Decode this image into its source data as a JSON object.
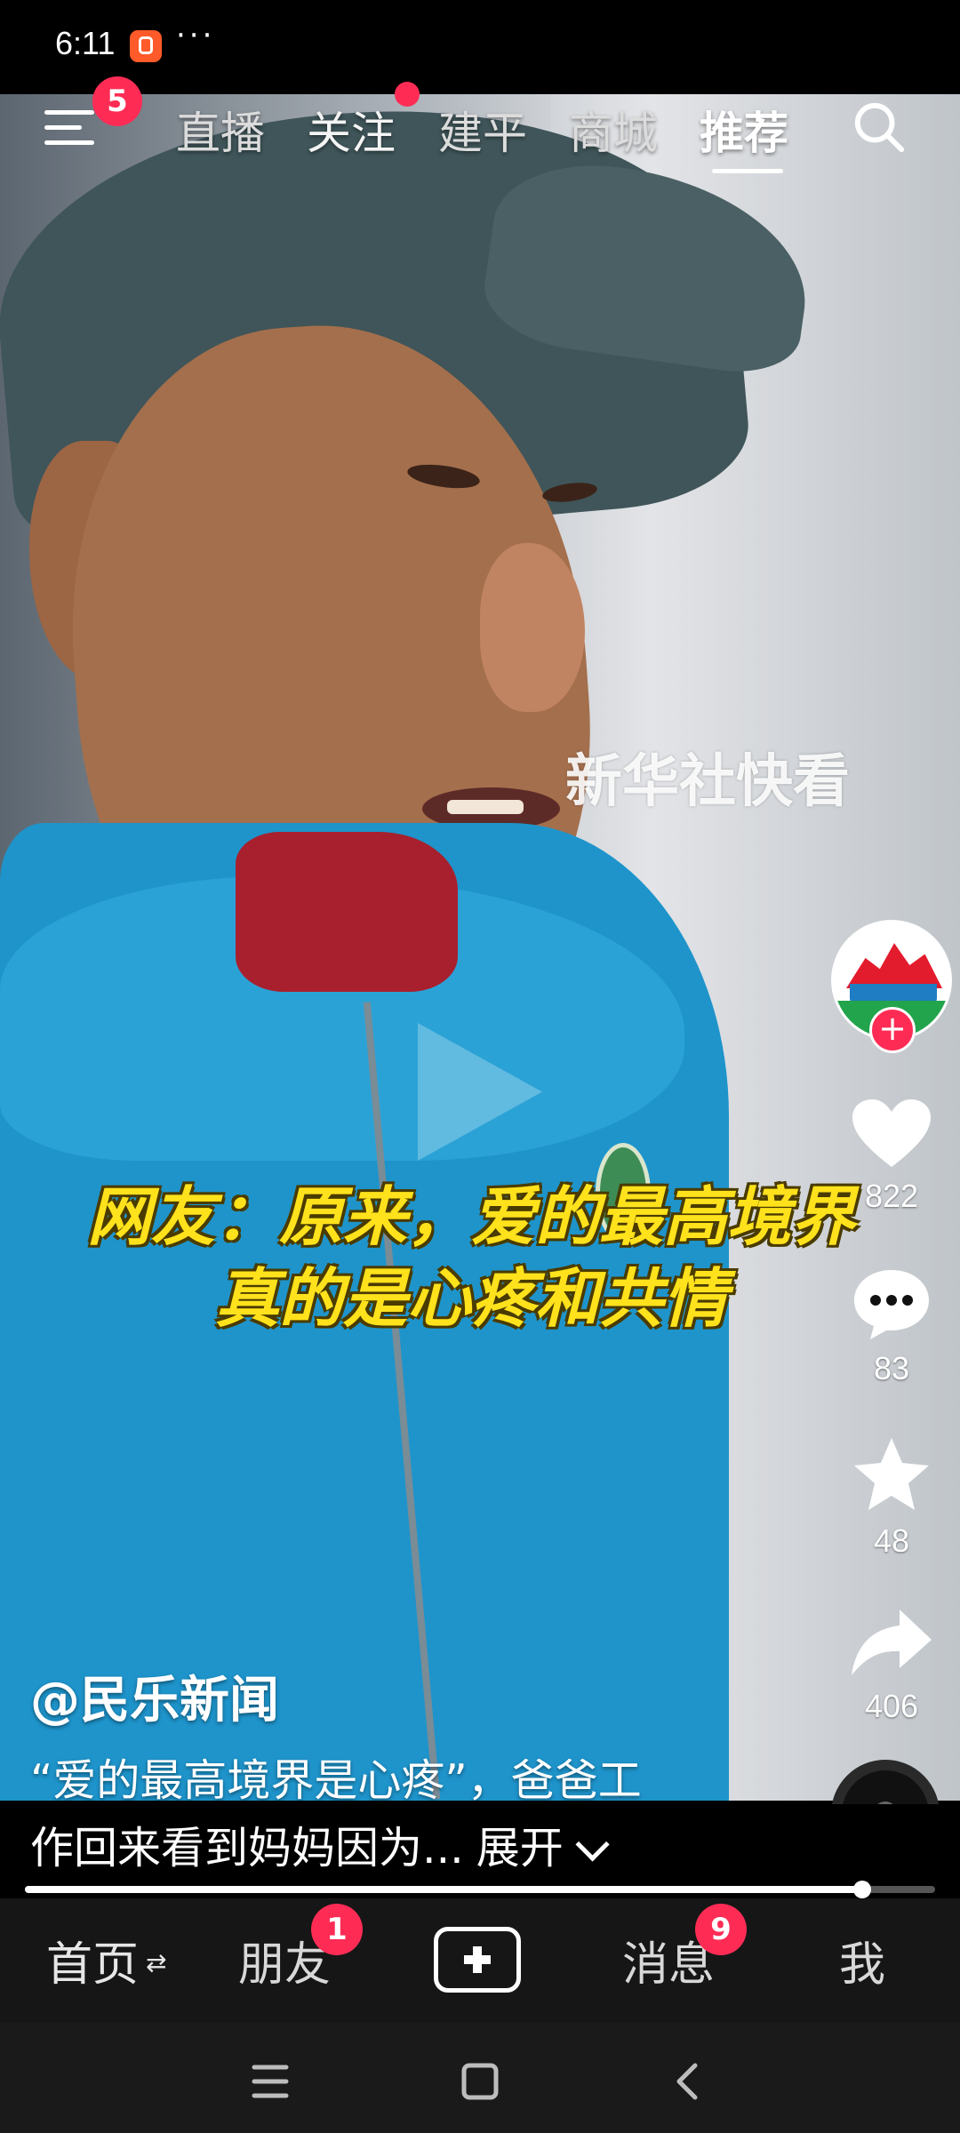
{
  "status_bar": {
    "time": "6:11",
    "app_icon": "camera-app-icon",
    "more": "···"
  },
  "top_nav": {
    "menu_badge": "5",
    "tabs": [
      {
        "label": "直播"
      },
      {
        "label": "关注"
      },
      {
        "label": "建平"
      },
      {
        "label": "商城"
      },
      {
        "label": "推荐"
      }
    ],
    "active_tab": "推荐"
  },
  "video": {
    "watermark": "新华社快看",
    "caption_line1": "网友：原来，爱的最高境界",
    "caption_line2": "真的是心疼和共情"
  },
  "side_actions": {
    "likes": "822",
    "comments": "83",
    "favorites": "48",
    "shares": "406"
  },
  "post": {
    "author": "@民乐新闻",
    "desc_line1": "“爱的最高境界是心疼”，爸爸工",
    "desc_line2": "作回来看到妈妈因为...",
    "expand": "展开"
  },
  "progress": {
    "played_fraction": 0.92
  },
  "bottom_nav": {
    "home": "首页",
    "home_swap": "⇄",
    "friends": "朋友",
    "friends_badge": "1",
    "messages": "消息",
    "messages_badge": "9",
    "me": "我"
  },
  "icons": {
    "menu": "menu-icon",
    "search": "search-icon",
    "like": "heart-icon",
    "comment": "comment-icon",
    "favorite": "star-icon",
    "share": "share-icon",
    "create": "plus-square-icon",
    "system_recent": "recent-apps-icon",
    "system_home": "home-square-icon",
    "system_back": "back-chevron-icon"
  },
  "colors": {
    "badge": "#fe2c55",
    "caption": "#ffe21c",
    "nav_bg": "#161616"
  }
}
